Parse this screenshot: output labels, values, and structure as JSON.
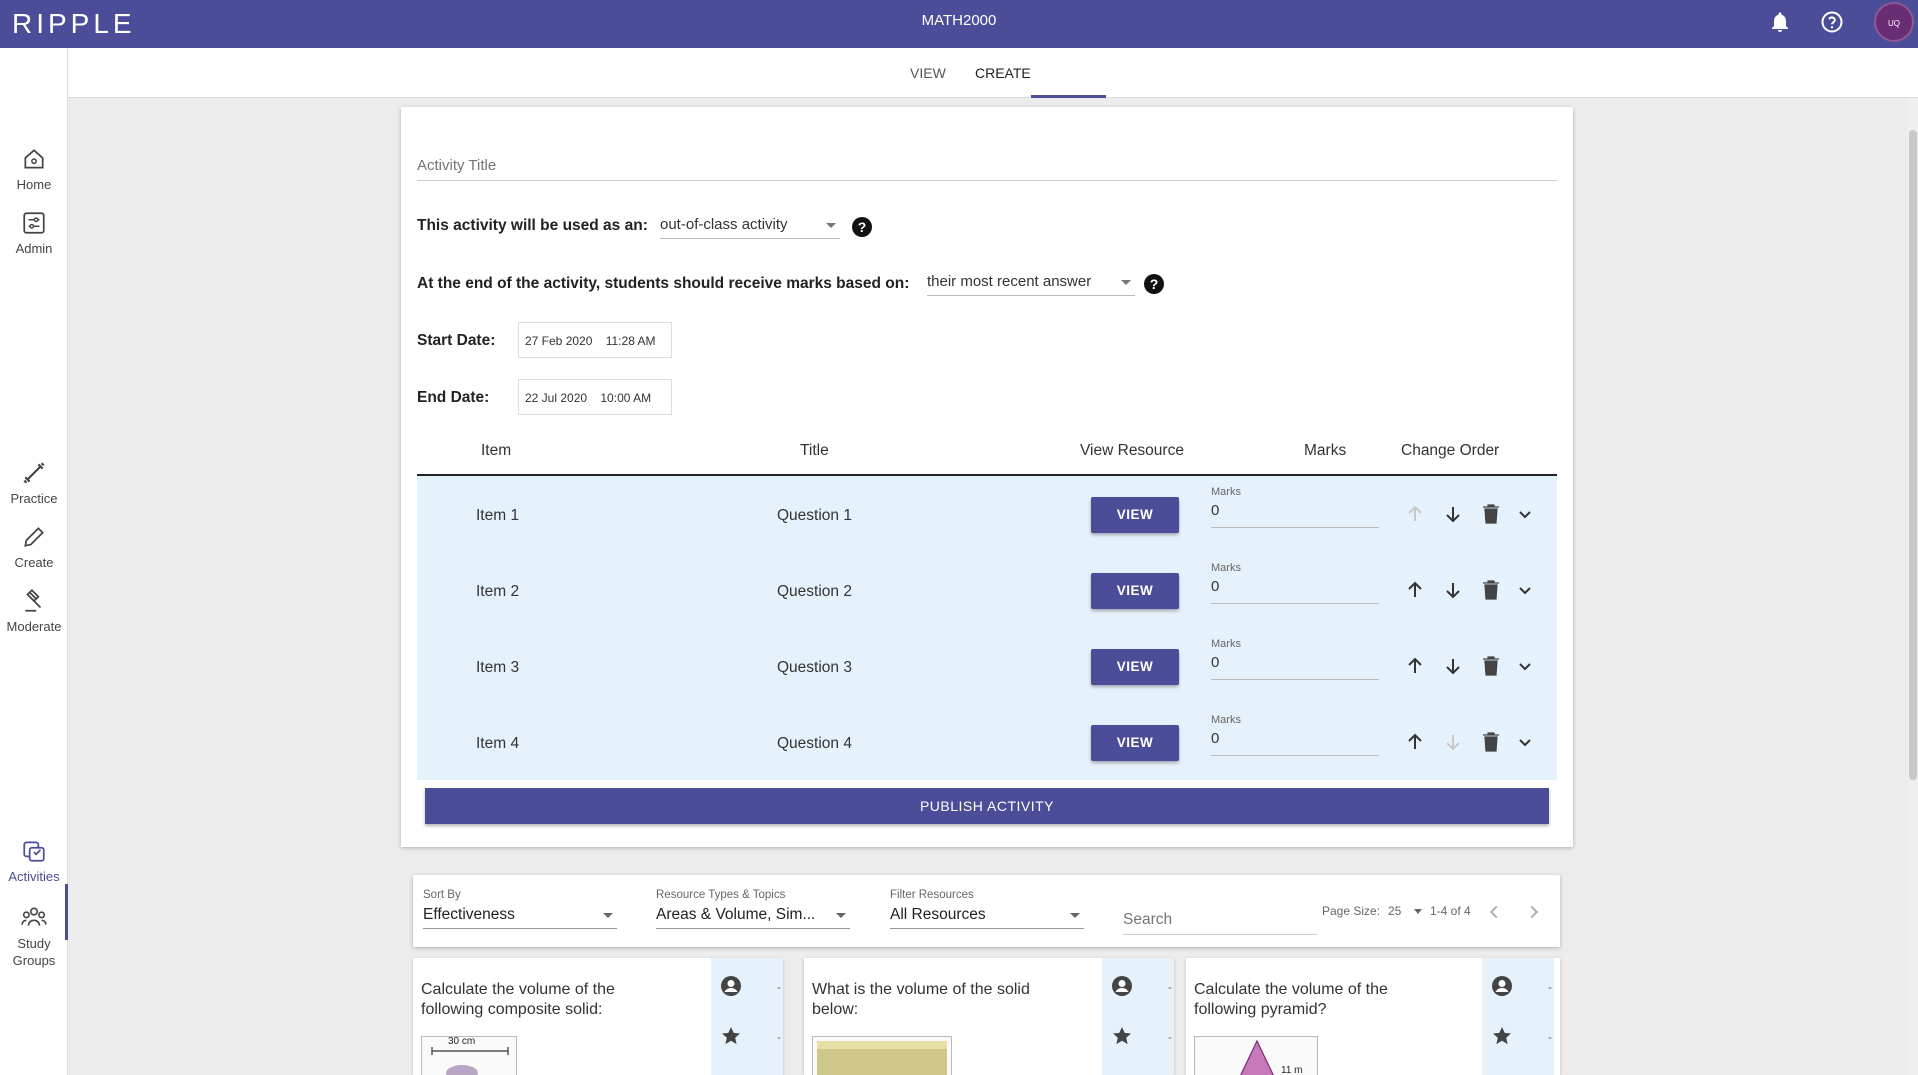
{
  "header": {
    "logo": "RIPPLE",
    "course": "MATH2000",
    "avatar_text": "UQ"
  },
  "tabs": [
    {
      "label": "VIEW"
    },
    {
      "label": "CREATE"
    }
  ],
  "sidebar": {
    "items": [
      {
        "label": "Home"
      },
      {
        "label": "Admin"
      },
      {
        "label": "Practice"
      },
      {
        "label": "Create"
      },
      {
        "label": "Moderate"
      },
      {
        "label": "Activities"
      },
      {
        "label": "Study Groups"
      }
    ]
  },
  "form": {
    "title_placeholder": "Activity Title",
    "usage_label": "This activity will be used as an:",
    "usage_value": "out-of-class activity",
    "marks_label": "At the end of the activity, students should receive marks based on:",
    "marks_value": "their most recent answer",
    "help": "?",
    "start_label": "Start Date:",
    "start_value": "27 Feb 2020    11:28 AM",
    "end_label": "End Date:",
    "end_value": "22 Jul 2020    10:00 AM"
  },
  "table": {
    "headers": {
      "item": "Item",
      "title": "Title",
      "view_resource": "View Resource",
      "marks": "Marks",
      "change_order": "Change Order"
    },
    "rows": [
      {
        "item": "Item 1",
        "title": "Question 1",
        "view": "VIEW",
        "marks_label": "Marks",
        "marks": "0"
      },
      {
        "item": "Item 2",
        "title": "Question 2",
        "view": "VIEW",
        "marks_label": "Marks",
        "marks": "0"
      },
      {
        "item": "Item 3",
        "title": "Question 3",
        "view": "VIEW",
        "marks_label": "Marks",
        "marks": "0"
      },
      {
        "item": "Item 4",
        "title": "Question 4",
        "view": "VIEW",
        "marks_label": "Marks",
        "marks": "0"
      }
    ],
    "publish": "PUBLISH ACTIVITY"
  },
  "filters": {
    "sort_label": "Sort By",
    "sort_value": "Effectiveness",
    "types_label": "Resource Types & Topics",
    "types_value": "Areas & Volume, Sim...",
    "filter_label": "Filter Resources",
    "filter_value": "All Resources",
    "search_placeholder": "Search",
    "page_size_label": "Page Size:",
    "page_size": "25",
    "range": "1-4 of 4"
  },
  "resources": [
    {
      "text": "Calculate the volume of the following composite solid:",
      "thumb_label": "30 cm",
      "author_count": "-",
      "rating": "-"
    },
    {
      "text": "What is the volume of the solid below:",
      "thumb_label": "",
      "author_count": "-",
      "rating": "-"
    },
    {
      "text": "Calculate the volume of the following pyramid?",
      "thumb_label": "11 m",
      "author_count": "-",
      "rating": "-"
    }
  ],
  "colors": {
    "primary": "#4b4d98",
    "row_highlight": "#e6f2fb"
  }
}
